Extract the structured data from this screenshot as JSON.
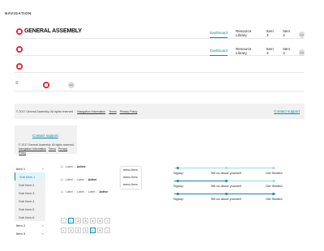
{
  "section_title": "NAVIGATION",
  "header1": {
    "brand": "GENERAL ASSEMBLY",
    "links": [
      "Dashboard",
      "Resource Library",
      "Item 3",
      "Item 4"
    ],
    "active": "Dashboard",
    "avatar": "GA"
  },
  "header2": {
    "links": [
      "Dashboard",
      "Resource Library",
      "Item 3",
      "Item 4"
    ],
    "active": "Dashboard",
    "avatar": "GA"
  },
  "header4": {
    "avatar": "GA"
  },
  "footer": {
    "copyright": "© 2017 General Assembly. All rights reserved.",
    "links": [
      "Navigation Information",
      "Terms",
      "Privacy Policy"
    ],
    "support": "Contact support"
  },
  "footer_compact": {
    "support": "Contact support",
    "copyright": "© 2017 General Assembly. All rights reserved.",
    "links": [
      "Navigation Information",
      "Terms",
      "Privacy Policy"
    ]
  },
  "sidebar": {
    "items": [
      {
        "label": "Item 1",
        "type": "parent",
        "chevron": "˄"
      },
      {
        "label": "Sub Item 1",
        "type": "child",
        "active": true
      },
      {
        "label": "Sub Item 2",
        "type": "child"
      },
      {
        "label": "Sub Item 3",
        "type": "child"
      },
      {
        "label": "Sub Item 4",
        "type": "child"
      },
      {
        "label": "Sub Item 5",
        "type": "child"
      },
      {
        "label": "Sub Item 6",
        "type": "child"
      },
      {
        "label": "Item 2",
        "type": "parent",
        "chevron": "˅"
      },
      {
        "label": "Item 3",
        "type": "parent",
        "chevron": "˅"
      }
    ]
  },
  "breadcrumbs": [
    [
      "Label",
      "Active"
    ],
    [
      "Label",
      "Label",
      "Active"
    ],
    [
      "Label",
      "Label",
      "Label",
      "Active"
    ]
  ],
  "menu": {
    "items": [
      "menu item",
      "menu item",
      "menu item"
    ]
  },
  "steppers": {
    "labels": [
      "Signup",
      "Tell us about yourself",
      "Get Started"
    ],
    "progress": [
      0.0,
      0.5,
      1.0
    ]
  },
  "pagination": [
    {
      "prev": "‹",
      "pages": [
        "1",
        "2",
        "3",
        "4",
        "5"
      ],
      "next": "›",
      "active": "1"
    },
    {
      "prev": "‹",
      "pages": [
        "1",
        "2",
        "3",
        "4",
        "5"
      ],
      "next": "›",
      "active": "4"
    }
  ],
  "colors": {
    "brand": "#e8212e",
    "accent": "#0d8aa8",
    "accent_light": "#9adbe6"
  },
  "icons": {
    "home": "home-icon",
    "hamburger": "hamburger-icon",
    "logo": "ga-logo-icon"
  }
}
